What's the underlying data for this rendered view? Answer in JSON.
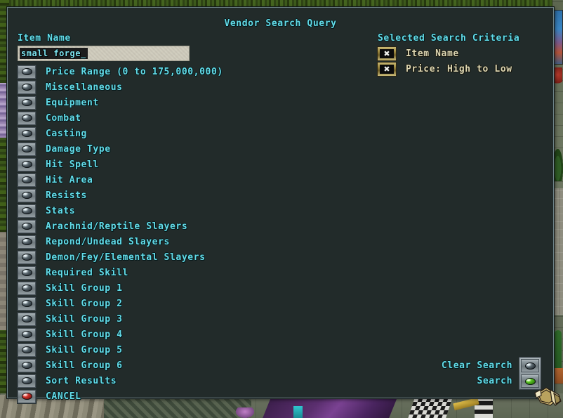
{
  "window": {
    "title": "Vendor Search Query"
  },
  "search_form": {
    "item_name_label": "Item Name",
    "name_input": {
      "value": "small forge_",
      "placeholder": "Item Name"
    },
    "options": [
      {
        "label": "Price Range (0 to 175,000,000)",
        "gem": "grey-gem-icon"
      },
      {
        "label": "Miscellaneous",
        "gem": "grey-gem-icon"
      },
      {
        "label": "Equipment",
        "gem": "grey-gem-icon"
      },
      {
        "label": "Combat",
        "gem": "grey-gem-icon"
      },
      {
        "label": "Casting",
        "gem": "grey-gem-icon"
      },
      {
        "label": "Damage Type",
        "gem": "grey-gem-icon"
      },
      {
        "label": "Hit Spell",
        "gem": "grey-gem-icon"
      },
      {
        "label": "Hit Area",
        "gem": "grey-gem-icon"
      },
      {
        "label": "Resists",
        "gem": "grey-gem-icon"
      },
      {
        "label": "Stats",
        "gem": "grey-gem-icon"
      },
      {
        "label": "Arachnid/Reptile Slayers",
        "gem": "grey-gem-icon"
      },
      {
        "label": "Repond/Undead Slayers",
        "gem": "grey-gem-icon"
      },
      {
        "label": "Demon/Fey/Elemental Slayers",
        "gem": "grey-gem-icon"
      },
      {
        "label": "Required Skill",
        "gem": "grey-gem-icon"
      },
      {
        "label": "Skill Group 1",
        "gem": "grey-gem-icon"
      },
      {
        "label": "Skill Group 2",
        "gem": "grey-gem-icon"
      },
      {
        "label": "Skill Group 3",
        "gem": "grey-gem-icon"
      },
      {
        "label": "Skill Group 4",
        "gem": "grey-gem-icon"
      },
      {
        "label": "Skill Group 5",
        "gem": "grey-gem-icon"
      },
      {
        "label": "Skill Group 6",
        "gem": "grey-gem-icon"
      },
      {
        "label": "Sort Results",
        "gem": "grey-gem-icon"
      },
      {
        "label": "CANCEL",
        "gem": "red-gem-icon"
      }
    ]
  },
  "criteria": {
    "title": "Selected Search Criteria",
    "items": [
      {
        "label": "Item Name",
        "remove_icon": "x-icon"
      },
      {
        "label": "Price: High to Low",
        "remove_icon": "x-icon"
      }
    ]
  },
  "actions": [
    {
      "label": "Clear Search",
      "gem": "grey-gem-icon"
    },
    {
      "label": "Search",
      "gem": "green-gem-icon"
    }
  ],
  "colors": {
    "panel_bg": "#222b2a",
    "panel_border": "#6f8489",
    "text_cyan": "#62dbe8",
    "text_tan": "#ded7b3",
    "input_bg": "#cfcbbc",
    "gem_red": "#d0342d",
    "gem_green": "#59c423"
  }
}
